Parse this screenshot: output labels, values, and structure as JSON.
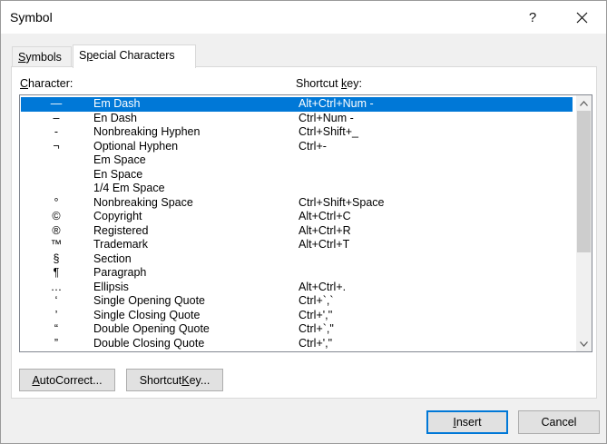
{
  "window": {
    "title": "Symbol",
    "help_glyph": "?",
    "close_icon": "close-icon"
  },
  "tabs": [
    {
      "pre": "",
      "key": "S",
      "post": "ymbols",
      "active": false
    },
    {
      "pre": "S",
      "key": "p",
      "post": "ecial Characters",
      "active": true
    }
  ],
  "headers": {
    "character_key": "C",
    "character_rest": "haracter:",
    "shortcut_pre": "Shortcut ",
    "shortcut_key": "k",
    "shortcut_post": "ey:"
  },
  "rows": [
    {
      "glyph": "—",
      "name": "Em Dash",
      "key": "Alt+Ctrl+Num -",
      "selected": true
    },
    {
      "glyph": "–",
      "name": "En Dash",
      "key": "Ctrl+Num -",
      "selected": false
    },
    {
      "glyph": "-",
      "name": "Nonbreaking Hyphen",
      "key": "Ctrl+Shift+_",
      "selected": false
    },
    {
      "glyph": "¬",
      "name": "Optional Hyphen",
      "key": "Ctrl+-",
      "selected": false
    },
    {
      "glyph": "",
      "name": "Em Space",
      "key": "",
      "selected": false
    },
    {
      "glyph": "",
      "name": "En Space",
      "key": "",
      "selected": false
    },
    {
      "glyph": "",
      "name": "1/4 Em Space",
      "key": "",
      "selected": false
    },
    {
      "glyph": "°",
      "name": "Nonbreaking Space",
      "key": "Ctrl+Shift+Space",
      "selected": false
    },
    {
      "glyph": "©",
      "name": "Copyright",
      "key": "Alt+Ctrl+C",
      "selected": false
    },
    {
      "glyph": "®",
      "name": "Registered",
      "key": "Alt+Ctrl+R",
      "selected": false
    },
    {
      "glyph": "™",
      "name": "Trademark",
      "key": "Alt+Ctrl+T",
      "selected": false
    },
    {
      "glyph": "§",
      "name": "Section",
      "key": "",
      "selected": false
    },
    {
      "glyph": "¶",
      "name": "Paragraph",
      "key": "",
      "selected": false
    },
    {
      "glyph": "…",
      "name": "Ellipsis",
      "key": "Alt+Ctrl+.",
      "selected": false
    },
    {
      "glyph": "‘",
      "name": "Single Opening Quote",
      "key": "Ctrl+`,`",
      "selected": false
    },
    {
      "glyph": "’",
      "name": "Single Closing Quote",
      "key": "Ctrl+',''",
      "selected": false
    },
    {
      "glyph": "“",
      "name": "Double Opening Quote",
      "key": "Ctrl+`,\"",
      "selected": false
    },
    {
      "glyph": "”",
      "name": "Double Closing Quote",
      "key": "Ctrl+',\"",
      "selected": false
    }
  ],
  "buttons": {
    "autocorrect_key": "A",
    "autocorrect_rest": "utoCorrect...",
    "shortcut_pre": "Shortcut ",
    "shortcut_key": "K",
    "shortcut_post": "ey...",
    "insert_key": "I",
    "insert_rest": "nsert",
    "cancel": "Cancel"
  },
  "colors": {
    "selection": "#0078d7",
    "dialog_bg": "#f0f0f0",
    "default_button_border": "#0078d7"
  }
}
